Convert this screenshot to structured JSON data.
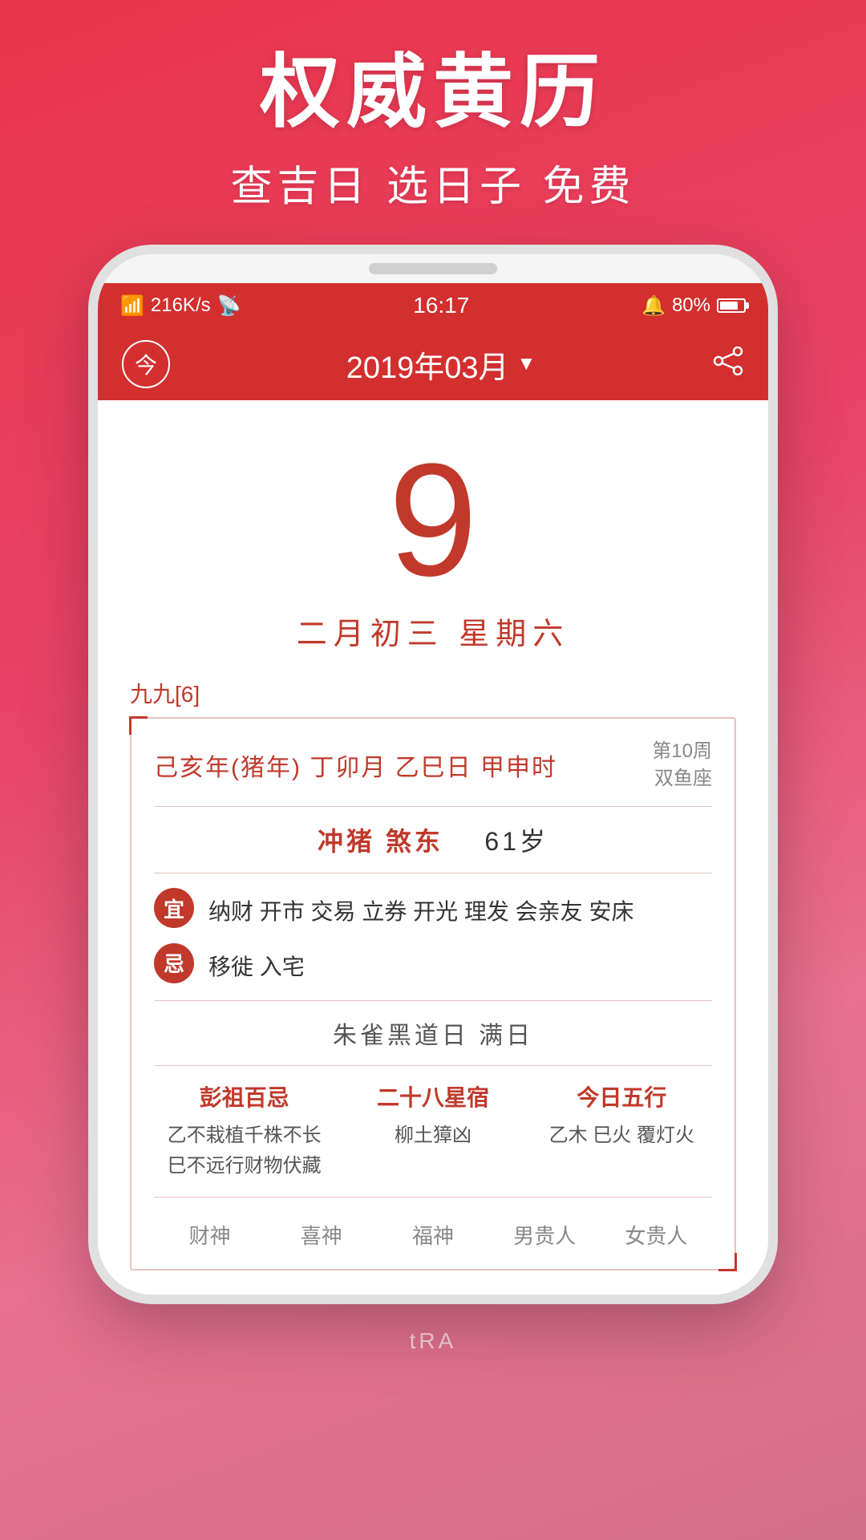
{
  "promo": {
    "title": "权威黄历",
    "subtitle": "查吉日 选日子 免费"
  },
  "status_bar": {
    "signal": "4G",
    "speed": "216K/s",
    "wifi": "WiFi",
    "time": "16:17",
    "alarm": "🔔",
    "battery_pct": "80%"
  },
  "app_header": {
    "today_label": "今",
    "month_display": "2019年03月",
    "dropdown_arrow": "▼"
  },
  "calendar": {
    "day_number": "9",
    "lunar_date": "二月初三  星期六",
    "nine_nine": "九九[6]",
    "year_info": "己亥年(猪年) 丁卯月  乙巳日  甲申时",
    "week_sign": "第10周",
    "zodiac": "双鱼座",
    "conflict": "冲猪  煞东",
    "age": "61岁",
    "good_label": "宜",
    "good_content": "纳财 开市 交易 立券 开光 理发 会亲友 安床",
    "bad_label": "忌",
    "bad_content": "移徙 入宅",
    "day_type": "朱雀黑道日  满日",
    "col1_title": "彭祖百忌",
    "col1_content": "乙不栽植千株不长\n巳不远行财物伏藏",
    "col2_title": "二十八星宿",
    "col2_content": "柳土獐凶",
    "col3_title": "今日五行",
    "col3_content": "乙木 巳火 覆灯火",
    "gods": [
      "财神",
      "喜神",
      "福神",
      "男贵人",
      "女贵人"
    ]
  },
  "bottom_watermark": "tRA"
}
